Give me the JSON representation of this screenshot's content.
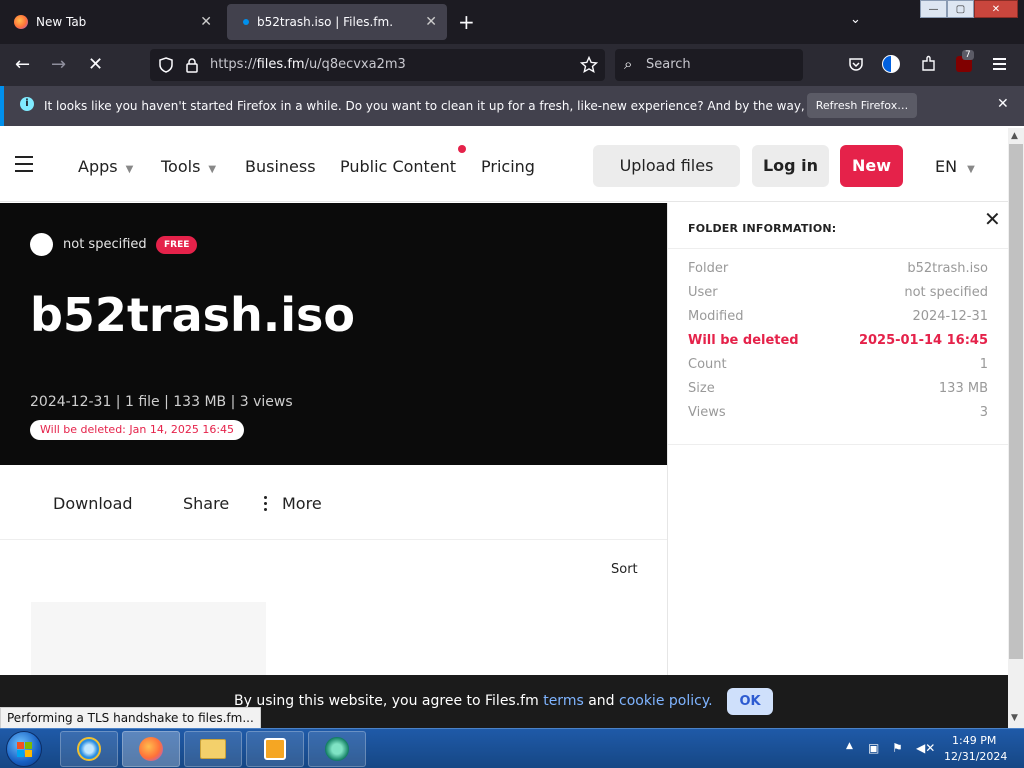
{
  "window": {
    "controls": {
      "minimize": "—",
      "maximize": "▢",
      "close": "✕"
    }
  },
  "tabs": [
    {
      "title": "New Tab",
      "close": "✕",
      "active": false
    },
    {
      "title": "b52trash.iso | Files.fm.",
      "close": "✕",
      "active": true
    }
  ],
  "tabbar": {
    "new_tab": "+",
    "list_tabs": "⌄"
  },
  "navbar": {
    "back": "←",
    "forward": "→",
    "stop": "✕",
    "url_scheme": "https://",
    "url_host": "files.fm",
    "url_path": "/u/q8ecvxa2m3",
    "search_placeholder": "Search",
    "extensions_badge": "7"
  },
  "notification": {
    "message": "It looks like you haven't started Firefox in a while. Do you want to clean it up for a fresh, like-new experience? And by the way, welcome back!",
    "button": "Refresh Firefox…",
    "close": "✕"
  },
  "site_header": {
    "menu": [
      {
        "label": "Apps",
        "has_caret": true
      },
      {
        "label": "Tools",
        "has_caret": true
      },
      {
        "label": "Business",
        "has_caret": false
      },
      {
        "label": "Public Content",
        "has_caret": false
      },
      {
        "label": "Pricing",
        "has_caret": false
      }
    ],
    "upload": "Upload files",
    "login": "Log in",
    "new": "New",
    "lang": "EN",
    "caret": "▼"
  },
  "hero": {
    "owner": "not specified",
    "badge": "FREE",
    "title": "b52trash.iso",
    "meta": "2024-12-31 | 1 file | 133 MB | 3 views",
    "delete_notice": "Will be deleted: Jan 14, 2025 16:45"
  },
  "actions": {
    "download": "Download",
    "share": "Share",
    "more": "More"
  },
  "sort": "Sort",
  "info_panel": {
    "title": "FOLDER INFORMATION:",
    "close": "✕",
    "rows": [
      {
        "key": "Folder",
        "value": "b52trash.iso"
      },
      {
        "key": "User",
        "value": "not specified"
      },
      {
        "key": "Modified",
        "value": "2024-12-31"
      },
      {
        "key": "Will be deleted",
        "value": "2025-01-14 16:45"
      },
      {
        "key": "Count",
        "value": "1"
      },
      {
        "key": "Size",
        "value": "133 MB"
      },
      {
        "key": "Views",
        "value": "3"
      }
    ]
  },
  "cookie": {
    "prefix": "By using this website, you agree to Files.fm ",
    "terms": "terms",
    "middle": " and ",
    "policy": "cookie policy.",
    "ok": "OK"
  },
  "status_text": "Performing a TLS handshake to files.fm...",
  "taskbar": {
    "time": "1:49 PM",
    "date": "12/31/2024"
  },
  "colors": {
    "accent_red": "#e5224a",
    "firefox_dark": "#1c1b22",
    "link_blue": "#7fb4ff"
  }
}
